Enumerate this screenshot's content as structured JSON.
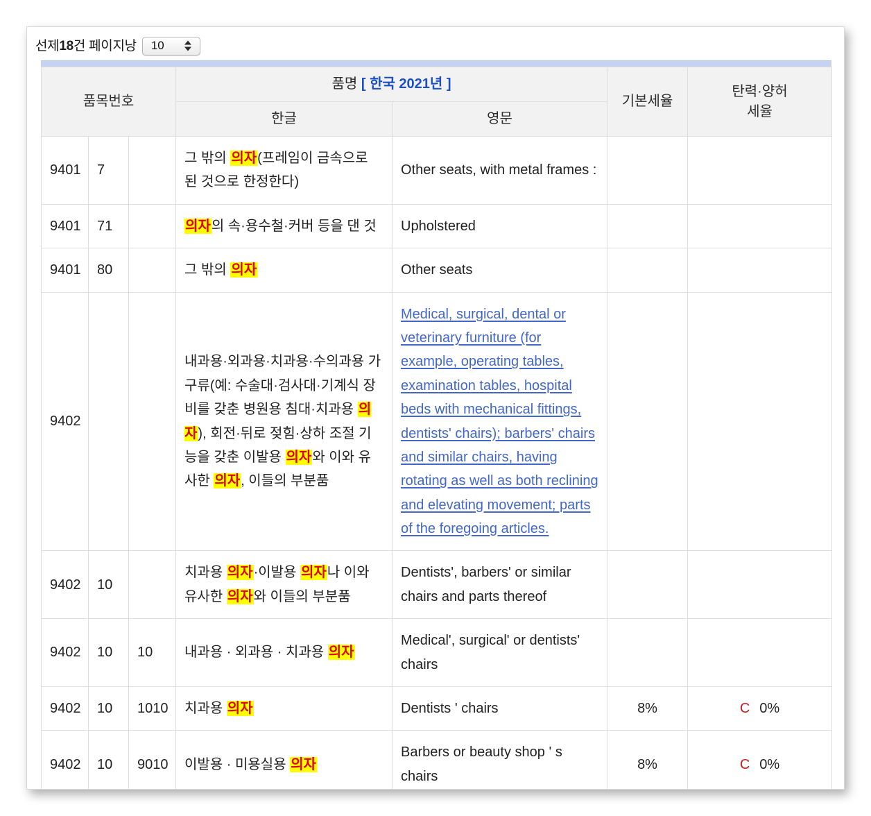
{
  "toolbar": {
    "label_prefix": "선제",
    "label_count": "18",
    "label_suffix": "건 페이지낭",
    "page_size_value": "10",
    "stepper_icon": "stepper-up-down-icon"
  },
  "colors": {
    "accent_rule": "#c6d2f1",
    "header_blue": "#1c4fc4",
    "highlight_bg": "#ffff00",
    "highlight_fg": "#e00000",
    "link": "#4267c9",
    "selected_row_bg": "#fdfde9",
    "code_red": "#c62020"
  },
  "table": {
    "headers": {
      "item_number": "품목번호",
      "name_group": "품명",
      "name_group_region": "[ 한국  2021년 ]",
      "korean": "한글",
      "english": "영문",
      "base_rate": "기본세율",
      "flex_rate_line1": "탄력·양허",
      "flex_rate_line2": "세율"
    },
    "rows": [
      {
        "code1": "9401",
        "code2": "7",
        "code3": "",
        "kor_parts": [
          {
            "t": "그 밖의 ",
            "h": false
          },
          {
            "t": "의자",
            "h": true
          },
          {
            "t": "(프레임이 금속으로 된 것으로 한정한다)",
            "h": false
          }
        ],
        "eng": "Other seats, with metal frames :",
        "eng_link": false,
        "base_rate": "",
        "flex_code": "",
        "flex_rate": "",
        "style": "plain"
      },
      {
        "code1": "9401",
        "code2": "71",
        "code3": "",
        "kor_parts": [
          {
            "t": "의자",
            "h": true
          },
          {
            "t": "의 속·용수철·커버 등을 댄 것",
            "h": false
          }
        ],
        "eng": "Upholstered",
        "eng_link": false,
        "base_rate": "",
        "flex_code": "",
        "flex_rate": "",
        "style": "alt"
      },
      {
        "code1": "9401",
        "code2": "80",
        "code3": "",
        "kor_parts": [
          {
            "t": "그 밖의 ",
            "h": false
          },
          {
            "t": "의자",
            "h": true
          }
        ],
        "eng": "Other seats",
        "eng_link": false,
        "base_rate": "",
        "flex_code": "",
        "flex_rate": "",
        "style": "plain"
      },
      {
        "code1": "9402",
        "code2": "",
        "code3": "",
        "kor_parts": [
          {
            "t": "내과용·외과용·치과용·수의과용 가구류(예: 수술대·검사대·기계식 장비를 갖춘 병원용 침대·치과용 ",
            "h": false
          },
          {
            "t": "의자",
            "h": true
          },
          {
            "t": "), 회전·뒤로 젖힘·상하 조절 기능을 갖춘 이발용 ",
            "h": false
          },
          {
            "t": "의자",
            "h": true
          },
          {
            "t": "와 이와 유사한 ",
            "h": false
          },
          {
            "t": "의자",
            "h": true
          },
          {
            "t": ", 이들의 부분품",
            "h": false
          }
        ],
        "eng": "Medical, surgical, dental or veterinary furniture (for example, operating tables, examination tables, hospital beds with mechanical fittings, dentists' chairs); barbers' chairs and similar chairs, having rotating as well as both reclining and elevating movement; parts of the foregoing articles.",
        "eng_link": true,
        "base_rate": "",
        "flex_code": "",
        "flex_rate": "",
        "style": "sel"
      },
      {
        "code1": "9402",
        "code2": "10",
        "code3": "",
        "kor_parts": [
          {
            "t": "치과용 ",
            "h": false
          },
          {
            "t": "의자",
            "h": true
          },
          {
            "t": "·이발용 ",
            "h": false
          },
          {
            "t": "의자",
            "h": true
          },
          {
            "t": "나 이와 유사한 ",
            "h": false
          },
          {
            "t": "의자",
            "h": true
          },
          {
            "t": "와 이들의 부분품",
            "h": false
          }
        ],
        "eng": "Dentists', barbers' or similar chairs and parts thereof",
        "eng_link": false,
        "base_rate": "",
        "flex_code": "",
        "flex_rate": "",
        "style": "plain"
      },
      {
        "code1": "9402",
        "code2": "10",
        "code3": "10",
        "kor_parts": [
          {
            "t": "내과용 · 외과용 · 치과용 ",
            "h": false
          },
          {
            "t": "의자",
            "h": true
          }
        ],
        "eng": "Medical', surgical' or dentists' chairs",
        "eng_link": false,
        "base_rate": "",
        "flex_code": "",
        "flex_rate": "",
        "style": "alt"
      },
      {
        "code1": "9402",
        "code2": "10",
        "code3": "1010",
        "kor_parts": [
          {
            "t": "치과용 ",
            "h": false
          },
          {
            "t": "의자",
            "h": true
          }
        ],
        "eng": "Dentists '  chairs",
        "eng_link": false,
        "base_rate": "8%",
        "flex_code": "C",
        "flex_rate": "0%",
        "style": "plain"
      },
      {
        "code1": "9402",
        "code2": "10",
        "code3": "9010",
        "kor_parts": [
          {
            "t": "이발용 · 미용실용 ",
            "h": false
          },
          {
            "t": "의자",
            "h": true
          }
        ],
        "eng": "Barbers or beauty shop ' s chairs",
        "eng_link": false,
        "base_rate": "8%",
        "flex_code": "C",
        "flex_rate": "0%",
        "style": "alt"
      }
    ]
  }
}
